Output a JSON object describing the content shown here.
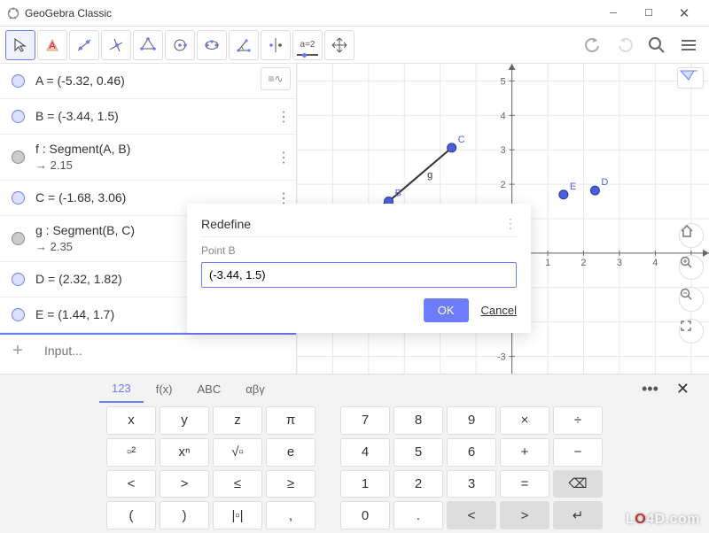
{
  "window": {
    "title": "GeoGebra Classic"
  },
  "toolbar": {
    "tools": [
      "move",
      "point",
      "line",
      "perp",
      "polygon",
      "circle",
      "ellipse",
      "angle",
      "reflect",
      "slider",
      "drag"
    ]
  },
  "algebra": {
    "toggle_label": "≡∿",
    "rows": [
      {
        "kind": "point",
        "text": "A = (-5.32, 0.46)"
      },
      {
        "kind": "point",
        "text": "B = (-3.44, 1.5)"
      },
      {
        "kind": "segment",
        "line1": "f : Segment(A, B)",
        "line2": "→  2.15"
      },
      {
        "kind": "point",
        "text": "C = (-1.68, 3.06)"
      },
      {
        "kind": "segment",
        "line1": "g : Segment(B, C)",
        "line2": "→  2.35"
      },
      {
        "kind": "point",
        "text": "D = (2.32, 1.82)"
      },
      {
        "kind": "point",
        "text": "E = (1.44, 1.7)"
      }
    ],
    "input_placeholder": "Input..."
  },
  "dialog": {
    "title": "Redefine",
    "subtitle": "Point B",
    "value": "(-3.44, 1.5)",
    "ok": "OK",
    "cancel": "Cancel"
  },
  "keyboard": {
    "tabs": [
      "123",
      "f(x)",
      "ABC",
      "αβγ"
    ],
    "active_tab": 0,
    "rows": [
      [
        "x",
        "y",
        "z",
        "π",
        "",
        "7",
        "8",
        "9",
        "×",
        "÷"
      ],
      [
        "▫²",
        "xⁿ",
        "√▫",
        "e",
        "",
        "4",
        "5",
        "6",
        "+",
        "−"
      ],
      [
        "<",
        ">",
        "≤",
        "≥",
        "",
        "1",
        "2",
        "3",
        "=",
        "⌫"
      ],
      [
        "(",
        ")",
        "|▫|",
        ",",
        "",
        "0",
        ".",
        "<",
        ">",
        "↵"
      ]
    ]
  },
  "chart_data": {
    "type": "scatter",
    "title": "",
    "xlabel": "",
    "ylabel": "",
    "xlim": [
      -6,
      5.5
    ],
    "ylim": [
      -3.5,
      5.5
    ],
    "points": [
      {
        "name": "A",
        "x": -5.32,
        "y": 0.46
      },
      {
        "name": "B",
        "x": -3.44,
        "y": 1.5
      },
      {
        "name": "C",
        "x": -1.68,
        "y": 3.06
      },
      {
        "name": "D",
        "x": 2.32,
        "y": 1.82
      },
      {
        "name": "E",
        "x": 1.44,
        "y": 1.7
      }
    ],
    "segments": [
      {
        "name": "f",
        "from": "A",
        "to": "B",
        "length": 2.15
      },
      {
        "name": "g",
        "from": "B",
        "to": "C",
        "length": 2.35
      }
    ]
  },
  "watermark": "LO4D.com"
}
